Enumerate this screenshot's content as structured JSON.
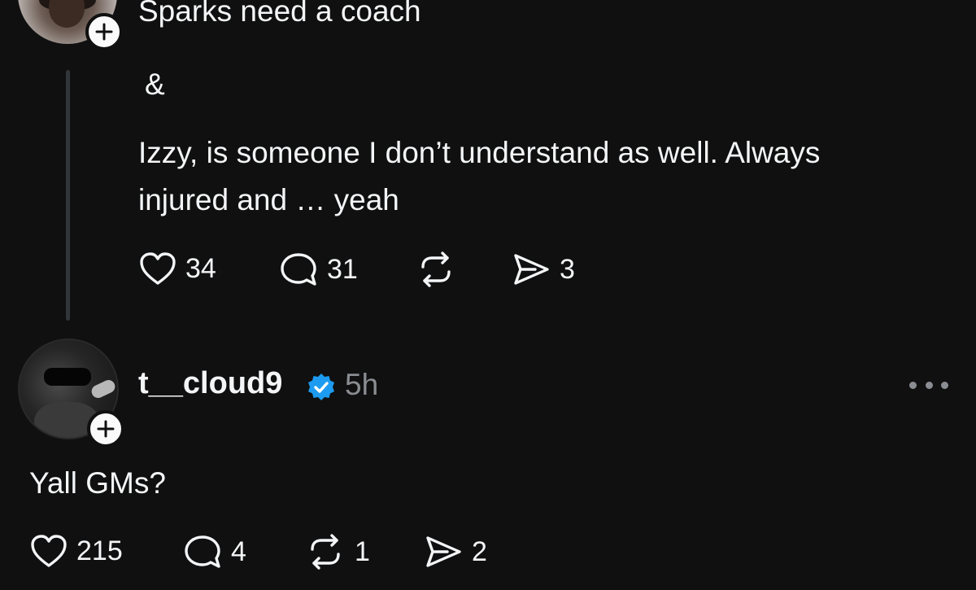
{
  "post1": {
    "lines": [
      "Sparks need a coach",
      "&",
      "Izzy, is someone I don’t understand as well. Always",
      "injured and … yeah"
    ],
    "likes": "34",
    "replies": "31",
    "reposts": "",
    "shares": "3"
  },
  "post2": {
    "username": "t__cloud9",
    "time": "5h",
    "text": "Yall GMs?",
    "likes": "215",
    "replies": "4",
    "reposts": "1",
    "shares": "2"
  },
  "colors": {
    "background": "#101010",
    "text": "#f3f5f7",
    "muted": "#8a8d91",
    "verified": "#1d9bf0"
  },
  "icons": [
    "heart-icon",
    "comment-icon",
    "repost-icon",
    "share-icon",
    "verified-badge-icon",
    "plus-icon",
    "more-icon"
  ]
}
